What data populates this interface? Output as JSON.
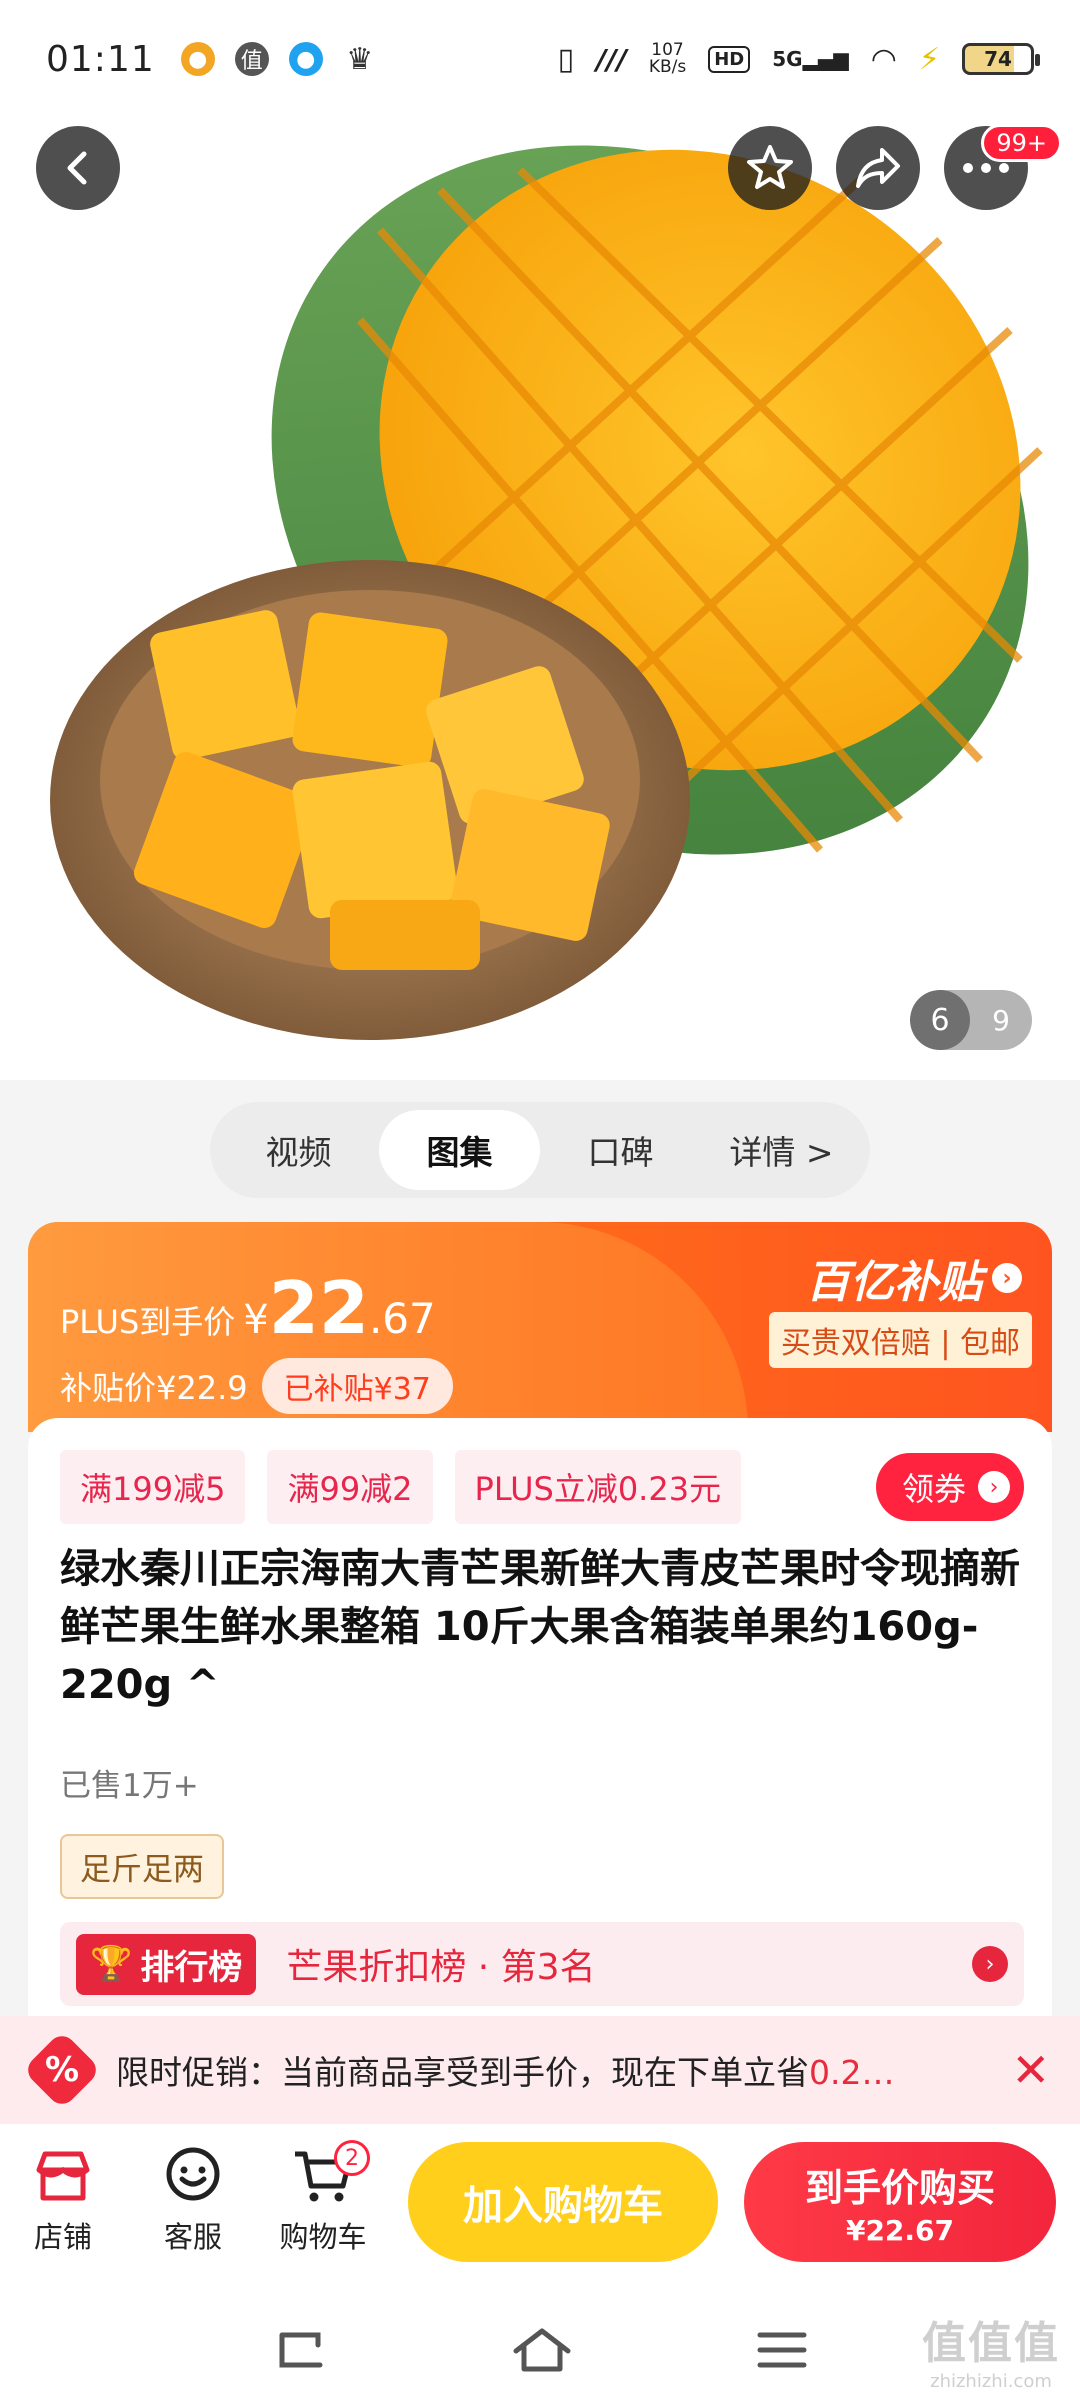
{
  "status_bar": {
    "time": "01:11",
    "net_speed_value": "107",
    "net_speed_unit": "KB/s",
    "hd": "HD",
    "signal": "5G",
    "battery": "74"
  },
  "gallery": {
    "current": "6",
    "total": "9",
    "more_badge": "99+",
    "tabs": [
      "视频",
      "图集",
      "口碑",
      "详情 >"
    ],
    "active_tab": "图集"
  },
  "price": {
    "plus_label": "PLUS到手价",
    "currency": "¥",
    "integer": "22",
    "decimal": ".67",
    "subsidy_label": "补贴价¥22.9",
    "subsidized_chip": "已补贴¥37",
    "brand": "百亿补贴",
    "guarantee": "买贵双倍赔 | 包邮"
  },
  "coupons": {
    "items": [
      "满199减5",
      "满99减2",
      "PLUS立减0.23元"
    ],
    "get_label": "领券"
  },
  "product": {
    "title": "绿水秦川正宗海南大青芒果新鲜大青皮芒果时令现摘新鲜芒果生鲜水果整箱 10斤大果含箱装单果约160g-220g ^",
    "sold": "已售1万+",
    "weight_tag": "足斤足两"
  },
  "ranking": {
    "badge": "排行榜",
    "text": "芒果折扣榜 · 第3名"
  },
  "promo": {
    "icon": "%",
    "text_prefix": "限时促销：当前商品享受到手价，现在下单立省",
    "text_highlight": "0.2…"
  },
  "actions": {
    "store": "店铺",
    "service": "客服",
    "cart": "购物车",
    "cart_count": "2",
    "add_to_cart": "加入购物车",
    "buy_label": "到手价购买",
    "buy_price": "¥22.67"
  },
  "watermark": {
    "logo": "值值值",
    "site": "zhizhizhi.com"
  },
  "colors": {
    "accent_red": "#ff2340",
    "price_orange": "#ff6a1a",
    "cart_yellow": "#ffcf1b"
  }
}
